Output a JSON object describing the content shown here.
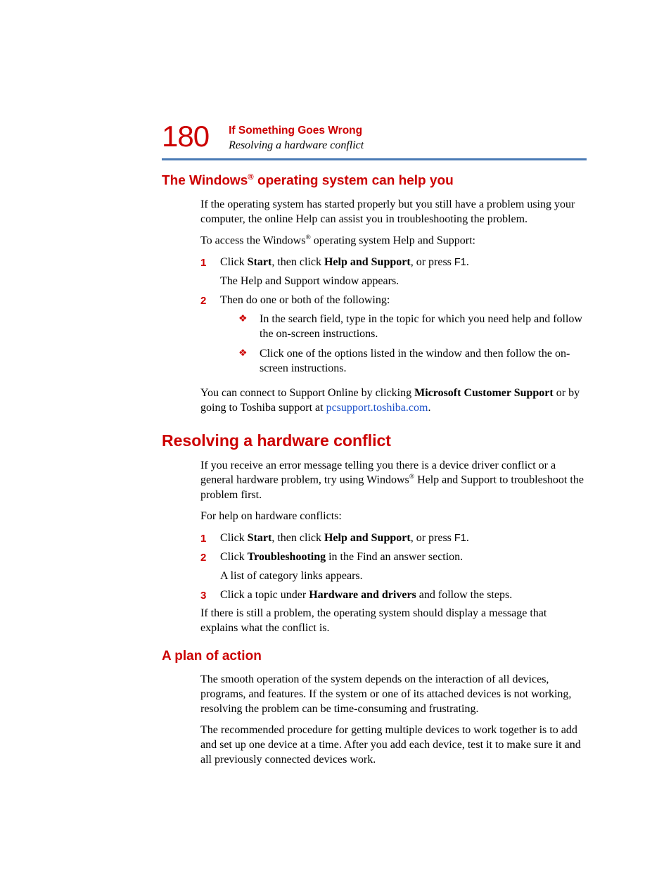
{
  "header": {
    "page_number": "180",
    "chapter": "If Something Goes Wrong",
    "section": "Resolving a hardware conflict"
  },
  "sec1": {
    "heading_pre": "The Windows",
    "heading_sup": "®",
    "heading_post": " operating system can help you",
    "p1": "If the operating system has started properly but you still have a problem using your computer, the online Help can assist you in troubleshooting the problem.",
    "p2_pre": "To access the Windows",
    "p2_sup": "®",
    "p2_post": " operating system Help and Support:",
    "step1_num": "1",
    "step1_a": "Click ",
    "step1_b": "Start",
    "step1_c": ", then click ",
    "step1_d": "Help and Support",
    "step1_e": ", or press ",
    "step1_key": "F1",
    "step1_f": ".",
    "step1_sub": "The Help and Support window appears.",
    "step2_num": "2",
    "step2_text": "Then do one or both of the following:",
    "bullet1": "In the search field, type in the topic for which you need help and follow the on-screen instructions.",
    "bullet2": "Click one of the options listed in the window and then follow the on-screen instructions.",
    "p3_a": "You can connect to Support Online by clicking ",
    "p3_b": "Microsoft Customer Support",
    "p3_c": " or by going to Toshiba support at ",
    "p3_link": "pcsupport.toshiba.com",
    "p3_d": "."
  },
  "sec2": {
    "heading": "Resolving a hardware conflict",
    "p1_a": "If you receive an error message telling you there is a device driver conflict or a general hardware problem, try using Windows",
    "p1_sup": "®",
    "p1_b": " Help and Support to troubleshoot the problem first.",
    "p2": "For help on hardware conflicts:",
    "step1_num": "1",
    "step1_a": "Click ",
    "step1_b": "Start",
    "step1_c": ", then click ",
    "step1_d": "Help and Support",
    "step1_e": ", or press ",
    "step1_key": "F1",
    "step1_f": ".",
    "step2_num": "2",
    "step2_a": "Click ",
    "step2_b": "Troubleshooting",
    "step2_c": " in the Find an answer section.",
    "step2_sub": "A list of category links appears.",
    "step3_num": "3",
    "step3_a": "Click a topic under ",
    "step3_b": "Hardware and drivers",
    "step3_c": " and follow the steps.",
    "p3": "If there is still a problem, the operating system should display a message that explains what the conflict is."
  },
  "sec3": {
    "heading": "A plan of action",
    "p1": "The smooth operation of the system depends on the interaction of all devices, programs, and features. If the system or one of its attached devices is not working, resolving the problem can be time-consuming and frustrating.",
    "p2": "The recommended procedure for getting multiple devices to work together is to add and set up one device at a time. After you add each device, test it to make sure it and all previously connected devices work."
  }
}
